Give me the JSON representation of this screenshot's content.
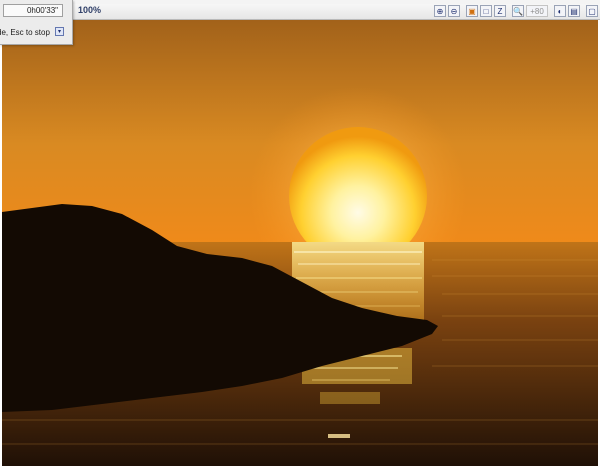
{
  "toolbar": {
    "zoom_label": "100%",
    "icons": [
      "zoom-in-icon",
      "zoom-out-icon",
      "render-region-icon",
      "frame-icon",
      "zoom-fit-icon",
      "zoom-level-icon",
      "channel-icon",
      "save-image-icon",
      "window-icon"
    ],
    "zoom_level_label": "+80"
  },
  "progress_panel": {
    "elapsed_time": "0h00'33\"",
    "hint": "de, Esc to stop"
  },
  "render": {
    "colors": {
      "sky_top": "#9a5a16",
      "sky_horizon": "#e48c1e",
      "sun_core": "#fff6c0",
      "sun_edge": "#f2a010",
      "sea": "#3a1f08",
      "rock": "#120903"
    }
  }
}
